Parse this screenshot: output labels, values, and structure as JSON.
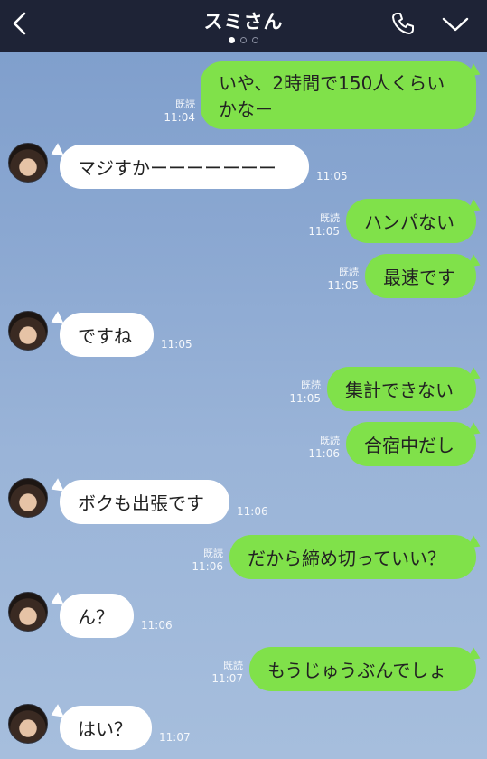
{
  "header": {
    "title": "スミさん",
    "page_count": 3,
    "active_page": 1
  },
  "colors": {
    "header_bg": "#1e2336",
    "outgoing_bubble": "#80e14a",
    "incoming_bubble": "#ffffff"
  },
  "messages": [
    {
      "side": "out",
      "text": "いや、2時間で150人くらいかなー",
      "line1": "いや、2時間で150人くらい",
      "line2": "かなー",
      "read": "既読",
      "time": "11:04"
    },
    {
      "side": "in",
      "text": "マジすかーーーーーーー",
      "time": "11:05"
    },
    {
      "side": "out",
      "text": "ハンパない",
      "read": "既読",
      "time": "11:05"
    },
    {
      "side": "out",
      "text": "最速です",
      "read": "既読",
      "time": "11:05"
    },
    {
      "side": "in",
      "text": "ですね",
      "time": "11:05"
    },
    {
      "side": "out",
      "text": "集計できない",
      "read": "既読",
      "time": "11:05"
    },
    {
      "side": "out",
      "text": "合宿中だし",
      "read": "既読",
      "time": "11:06"
    },
    {
      "side": "in",
      "text": "ボクも出張です",
      "time": "11:06"
    },
    {
      "side": "out",
      "text": "だから締め切っていい？",
      "read": "既読",
      "time": "11:06"
    },
    {
      "side": "in",
      "text": "ん？",
      "time": "11:06"
    },
    {
      "side": "out",
      "text": "もうじゅうぶんでしょ",
      "read": "既読",
      "time": "11:07"
    },
    {
      "side": "in",
      "text": "はい？",
      "time": "11:07"
    }
  ]
}
